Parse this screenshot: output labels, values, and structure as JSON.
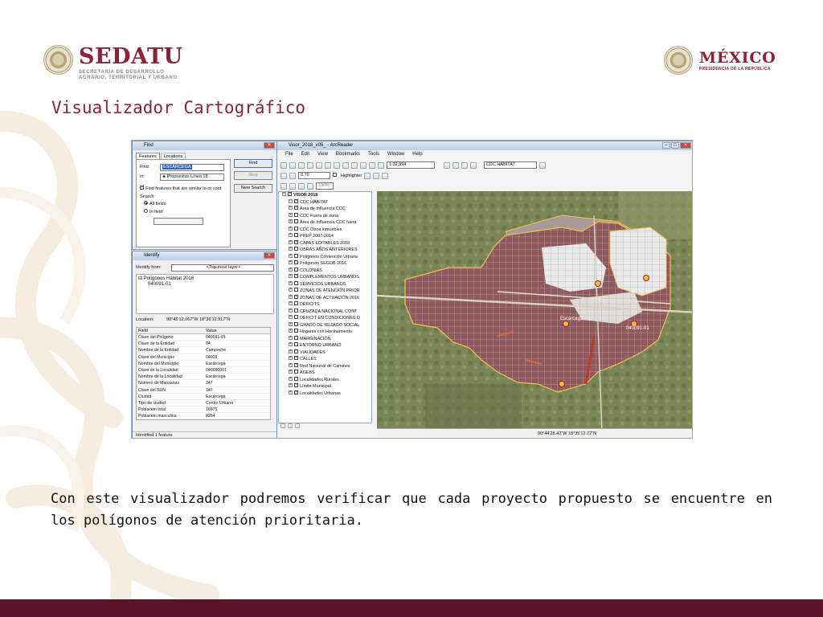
{
  "header": {
    "left_brand": "SEDATU",
    "left_subtitle_line1": "SECRETARÍA DE DESARROLLO",
    "left_subtitle_line2": "AGRARIO, TERRITORIAL Y URBANO",
    "right_brand": "MÉXICO",
    "right_subtitle": "PRESIDENCIA DE LA REPÚBLICA"
  },
  "title": "Visualizador Cartográfico",
  "caption": "Con este visualizador podremos verificar que cada proyecto propuesto se encuentre en los polígonos de atención prioritaria.",
  "colors": {
    "brand": "#8c2137",
    "footer": "#5b1529",
    "polygon": "#8e5a5f",
    "map_bg": "#7e8a58"
  },
  "find_dialog": {
    "title": "Find",
    "tabs": [
      "Features",
      "Locations"
    ],
    "find_label": "Find:",
    "find_value": "ESCÁRCEGA",
    "in_label": "In:",
    "in_value": "Propuestas Línea 18",
    "checkbox_label": "Find features that are similar to or cont",
    "search_label": "Search:",
    "radio_all": "All fields",
    "radio_in": "In field:",
    "buttons": {
      "find": "Find",
      "stop": "Stop",
      "new_search": "New Search"
    }
  },
  "identify": {
    "title": "Identify",
    "from_label": "Identify from:",
    "from_value": "<Top-most layer>",
    "tree_parent": "Polígonos Hábitat 2018",
    "tree_child": "040091-01",
    "location_label": "Location:",
    "location_value": "90°45'12.067\"W  18°36'12.917\"N",
    "col_field": "Field",
    "col_value": "Value",
    "rows": [
      [
        "Clave del Polígono",
        "040091-01"
      ],
      [
        "Clave de la Entidad",
        "04"
      ],
      [
        "Nombre de la Entidad",
        "Campeche"
      ],
      [
        "Clave del Municipio",
        "04009"
      ],
      [
        "Nombre del Municipio",
        "Escárcega"
      ],
      [
        "Clave de la Localidad",
        "040090001"
      ],
      [
        "Nombre de la Localidad",
        "Escárcega"
      ],
      [
        "Número de Manzanas",
        "347"
      ],
      [
        "Clave del SUN",
        "147"
      ],
      [
        "Ciudad",
        "Escárcega"
      ],
      [
        "Tipo de ciudad",
        "Centro Urbano"
      ],
      [
        "Población total",
        "16975"
      ],
      [
        "Población masculina",
        "8254"
      ]
    ],
    "status": "Identified 1 feature"
  },
  "arcreader": {
    "title": "Visor_2018_v05_ - ArcReader",
    "menu": [
      "File",
      "Edit",
      "View",
      "Bookmarks",
      "Tools",
      "Window",
      "Help"
    ],
    "scale": "1:32,994",
    "layer_select": "CDC HÁBITAT",
    "size_value": "0.70",
    "highlighter": "Highlighter",
    "zoom": "100%",
    "coords": "90°44'28.42\"W  18°35'12.72\"N",
    "map_labels": [
      "Escárcega",
      "040091-01"
    ],
    "toc": [
      {
        "label": "VISOR 2018",
        "level": 0,
        "checked": true,
        "exp": "−"
      },
      {
        "label": "CDC HÁBITAT",
        "level": 1,
        "checked": true,
        "exp": "−"
      },
      {
        "label": "Área de Influencia CDC",
        "level": 1,
        "checked": true,
        "exp": "+"
      },
      {
        "label": "CDC Fuera de zona",
        "level": 1,
        "checked": false,
        "exp": "+"
      },
      {
        "label": "Área de Influencia CDC fuera",
        "level": 1,
        "checked": false,
        "exp": "+"
      },
      {
        "label": "CDC Otros inmuebles",
        "level": 1,
        "checked": false,
        "exp": "+"
      },
      {
        "label": "PREP 2007-2014",
        "level": 1,
        "checked": false,
        "exp": "+"
      },
      {
        "label": "CAPAS EDITABLES 2018",
        "level": 1,
        "checked": true,
        "exp": "+"
      },
      {
        "label": "OBRAS AÑOS ANTERIORES",
        "level": 1,
        "checked": false,
        "exp": "+"
      },
      {
        "label": "Polígonos Contención Urbana",
        "level": 1,
        "checked": false,
        "exp": "+"
      },
      {
        "label": "Polígonos SEGOB 2016",
        "level": 1,
        "checked": false,
        "exp": "+"
      },
      {
        "label": "COLONIAS",
        "level": 1,
        "checked": false,
        "exp": "+"
      },
      {
        "label": "COMPLEMENTOS URBANOS",
        "level": 1,
        "checked": true,
        "exp": "+"
      },
      {
        "label": "SERVICIOS URBANOS",
        "level": 1,
        "checked": false,
        "exp": "+"
      },
      {
        "label": "ZONAS DE ATENCIÓN PRIOR",
        "level": 1,
        "checked": false,
        "exp": "+"
      },
      {
        "label": "ZONAS DE ACTUACIÓN 2016",
        "level": 1,
        "checked": true,
        "exp": "+"
      },
      {
        "label": "DÉFICITS",
        "level": 1,
        "checked": false,
        "exp": "+"
      },
      {
        "label": "CRUZADA NACIONAL CONT",
        "level": 1,
        "checked": false,
        "exp": "+"
      },
      {
        "label": "DÉFICIT EN CONDICIONES D",
        "level": 1,
        "checked": false,
        "exp": "+"
      },
      {
        "label": "GRADO DE REZAGO SOCIAL",
        "level": 1,
        "checked": false,
        "exp": "+"
      },
      {
        "label": "Hogares con Hacinamiento",
        "level": 1,
        "checked": false,
        "exp": "+"
      },
      {
        "label": "MARGINACIÓN",
        "level": 1,
        "checked": false,
        "exp": "+"
      },
      {
        "label": "ENTORNO URBANO",
        "level": 1,
        "checked": false,
        "exp": "+"
      },
      {
        "label": "VIALIDADES",
        "level": 1,
        "checked": false,
        "exp": "+"
      },
      {
        "label": "CALLES",
        "level": 1,
        "checked": true,
        "exp": "+"
      },
      {
        "label": "Red Nacional de Caminos",
        "level": 1,
        "checked": true,
        "exp": "+"
      },
      {
        "label": "AGEBS",
        "level": 1,
        "checked": false,
        "exp": "+"
      },
      {
        "label": "Localidades Rurales",
        "level": 1,
        "checked": false,
        "exp": "+"
      },
      {
        "label": "Límite Municipal",
        "level": 1,
        "checked": true,
        "exp": "+"
      },
      {
        "label": "Localidades Urbanas",
        "level": 1,
        "checked": true,
        "exp": "+"
      }
    ]
  }
}
